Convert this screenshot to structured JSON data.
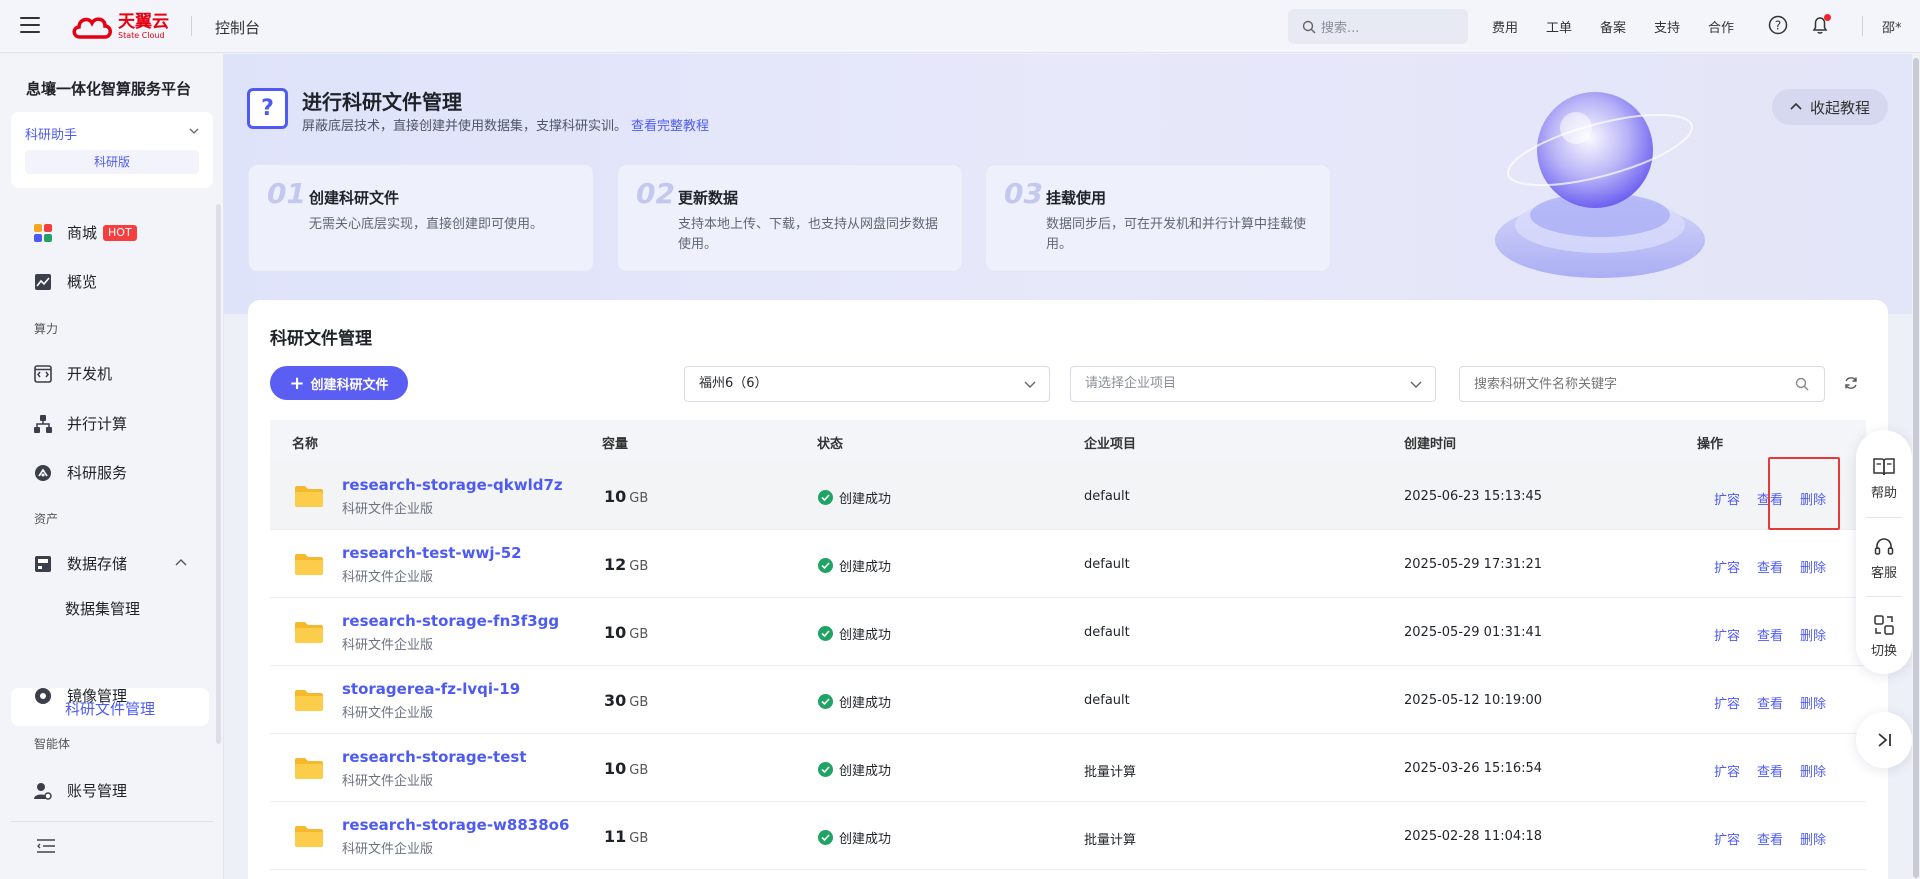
{
  "topbar": {
    "logo_cn": "天翼云",
    "logo_en": "State Cloud",
    "console": "控制台",
    "search_placeholder": "搜索...",
    "links": [
      "费用",
      "工单",
      "备案",
      "支持",
      "合作"
    ],
    "user": "邵*"
  },
  "sidebar": {
    "platform_title": "息壤一体化智算服务平台",
    "assistant": "科研助手",
    "edition": "科研版",
    "items": {
      "mall": "商城",
      "hot": "HOT",
      "overview": "概览",
      "group_compute": "算力",
      "devbox": "开发机",
      "parallel": "并行计算",
      "research_service": "科研服务",
      "group_assets": "资产",
      "data_storage": "数据存储",
      "dataset_mgmt": "数据集管理",
      "research_file_mgmt": "科研文件管理",
      "image_mgmt": "镜像管理",
      "group_agent": "智能体",
      "account_mgmt": "账号管理"
    }
  },
  "banner": {
    "title": "进行科研文件管理",
    "desc": "屏蔽底层技术，直接创建并使用数据集，支撑科研实训。",
    "tutorial_link": "查看完整教程",
    "collapse": "收起教程",
    "steps": [
      {
        "num": "01",
        "title": "创建科研文件",
        "desc": "无需关心底层实现，直接创建即可使用。"
      },
      {
        "num": "02",
        "title": "更新数据",
        "desc": "支持本地上传、下载，也支持从网盘同步数据使用。"
      },
      {
        "num": "03",
        "title": "挂载使用",
        "desc": "数据同步后，可在开发机和并行计算中挂载使用。"
      }
    ]
  },
  "main": {
    "title": "科研文件管理",
    "create_btn": "创建科研文件",
    "region": "福州6（6）",
    "project_placeholder": "请选择企业项目",
    "search_placeholder": "搜索科研文件名称关键字",
    "columns": [
      "名称",
      "容量",
      "状态",
      "企业项目",
      "创建时间",
      "操作"
    ],
    "actions": [
      "扩容",
      "查看",
      "删除"
    ],
    "rows": [
      {
        "name": "research-storage-qkwld7z",
        "sub": "科研文件企业版",
        "cap": "10",
        "unit": "GB",
        "status": "创建成功",
        "project": "default",
        "time": "2025-06-23 15:13:45"
      },
      {
        "name": "research-test-wwj-52",
        "sub": "科研文件企业版",
        "cap": "12",
        "unit": "GB",
        "status": "创建成功",
        "project": "default",
        "time": "2025-05-29 17:31:21"
      },
      {
        "name": "research-storage-fn3f3gg",
        "sub": "科研文件企业版",
        "cap": "10",
        "unit": "GB",
        "status": "创建成功",
        "project": "default",
        "time": "2025-05-29 01:31:41"
      },
      {
        "name": "storagerea-fz-lvqi-19",
        "sub": "科研文件企业版",
        "cap": "30",
        "unit": "GB",
        "status": "创建成功",
        "project": "default",
        "time": "2025-05-12 10:19:00"
      },
      {
        "name": "research-storage-test",
        "sub": "科研文件企业版",
        "cap": "10",
        "unit": "GB",
        "status": "创建成功",
        "project": "批量计算",
        "time": "2025-03-26 15:16:54"
      },
      {
        "name": "research-storage-w8838o6",
        "sub": "科研文件企业版",
        "cap": "11",
        "unit": "GB",
        "status": "创建成功",
        "project": "批量计算",
        "time": "2025-02-28 11:04:18"
      }
    ]
  },
  "float_panel": {
    "help": "帮助",
    "service": "客服",
    "switch": "切换"
  },
  "colors": {
    "accent": "#4e5bf2",
    "primary_button": "#5b5ef2",
    "success": "#21a366",
    "brand_red": "#e60012",
    "highlight_box": "#e23b3b"
  }
}
